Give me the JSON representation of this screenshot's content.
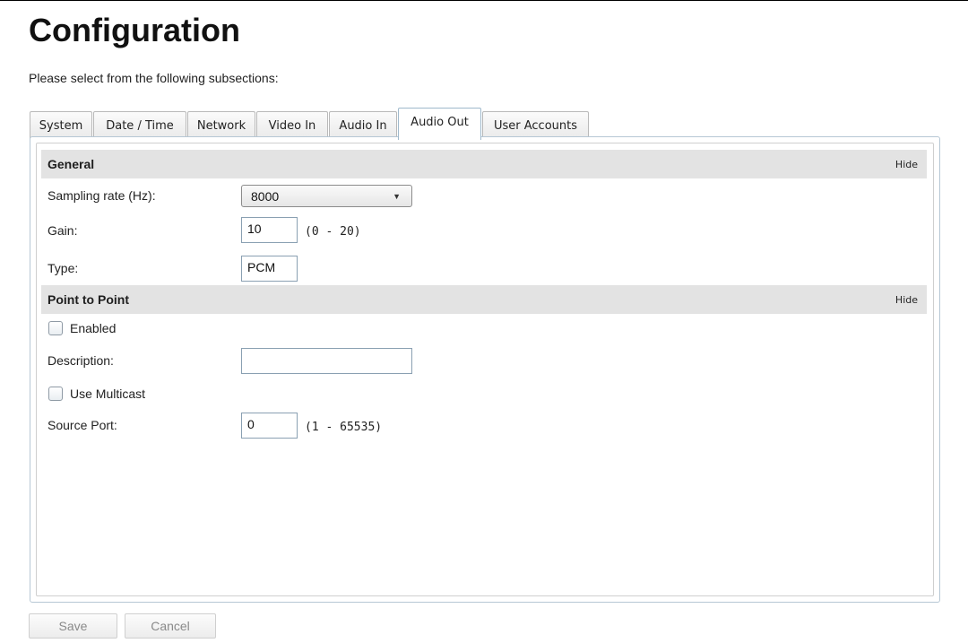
{
  "page": {
    "title": "Configuration",
    "intro": "Please select from the following subsections:"
  },
  "tabs": [
    {
      "label": "System"
    },
    {
      "label": "Date / Time"
    },
    {
      "label": "Network"
    },
    {
      "label": "Video In"
    },
    {
      "label": "Audio In"
    },
    {
      "label": "Audio Out",
      "active": true
    },
    {
      "label": "User Accounts"
    }
  ],
  "general": {
    "title": "General",
    "hide_label": "Hide",
    "sampling_rate_label": "Sampling rate (Hz):",
    "sampling_rate_value": "8000",
    "gain_label": "Gain:",
    "gain_value": "10",
    "gain_range": "(0 - 20)",
    "type_label": "Type:",
    "type_value": "PCM"
  },
  "p2p": {
    "title": "Point to Point",
    "hide_label": "Hide",
    "enabled_label": "Enabled",
    "enabled_checked": false,
    "description_label": "Description:",
    "description_value": "",
    "multicast_label": "Use Multicast",
    "multicast_checked": false,
    "source_port_label": "Source Port:",
    "source_port_value": "0",
    "source_port_range": "(1 - 65535)"
  },
  "buttons": {
    "save": "Save",
    "cancel": "Cancel"
  },
  "icons": {
    "dropdown": "chevron-down-icon"
  }
}
